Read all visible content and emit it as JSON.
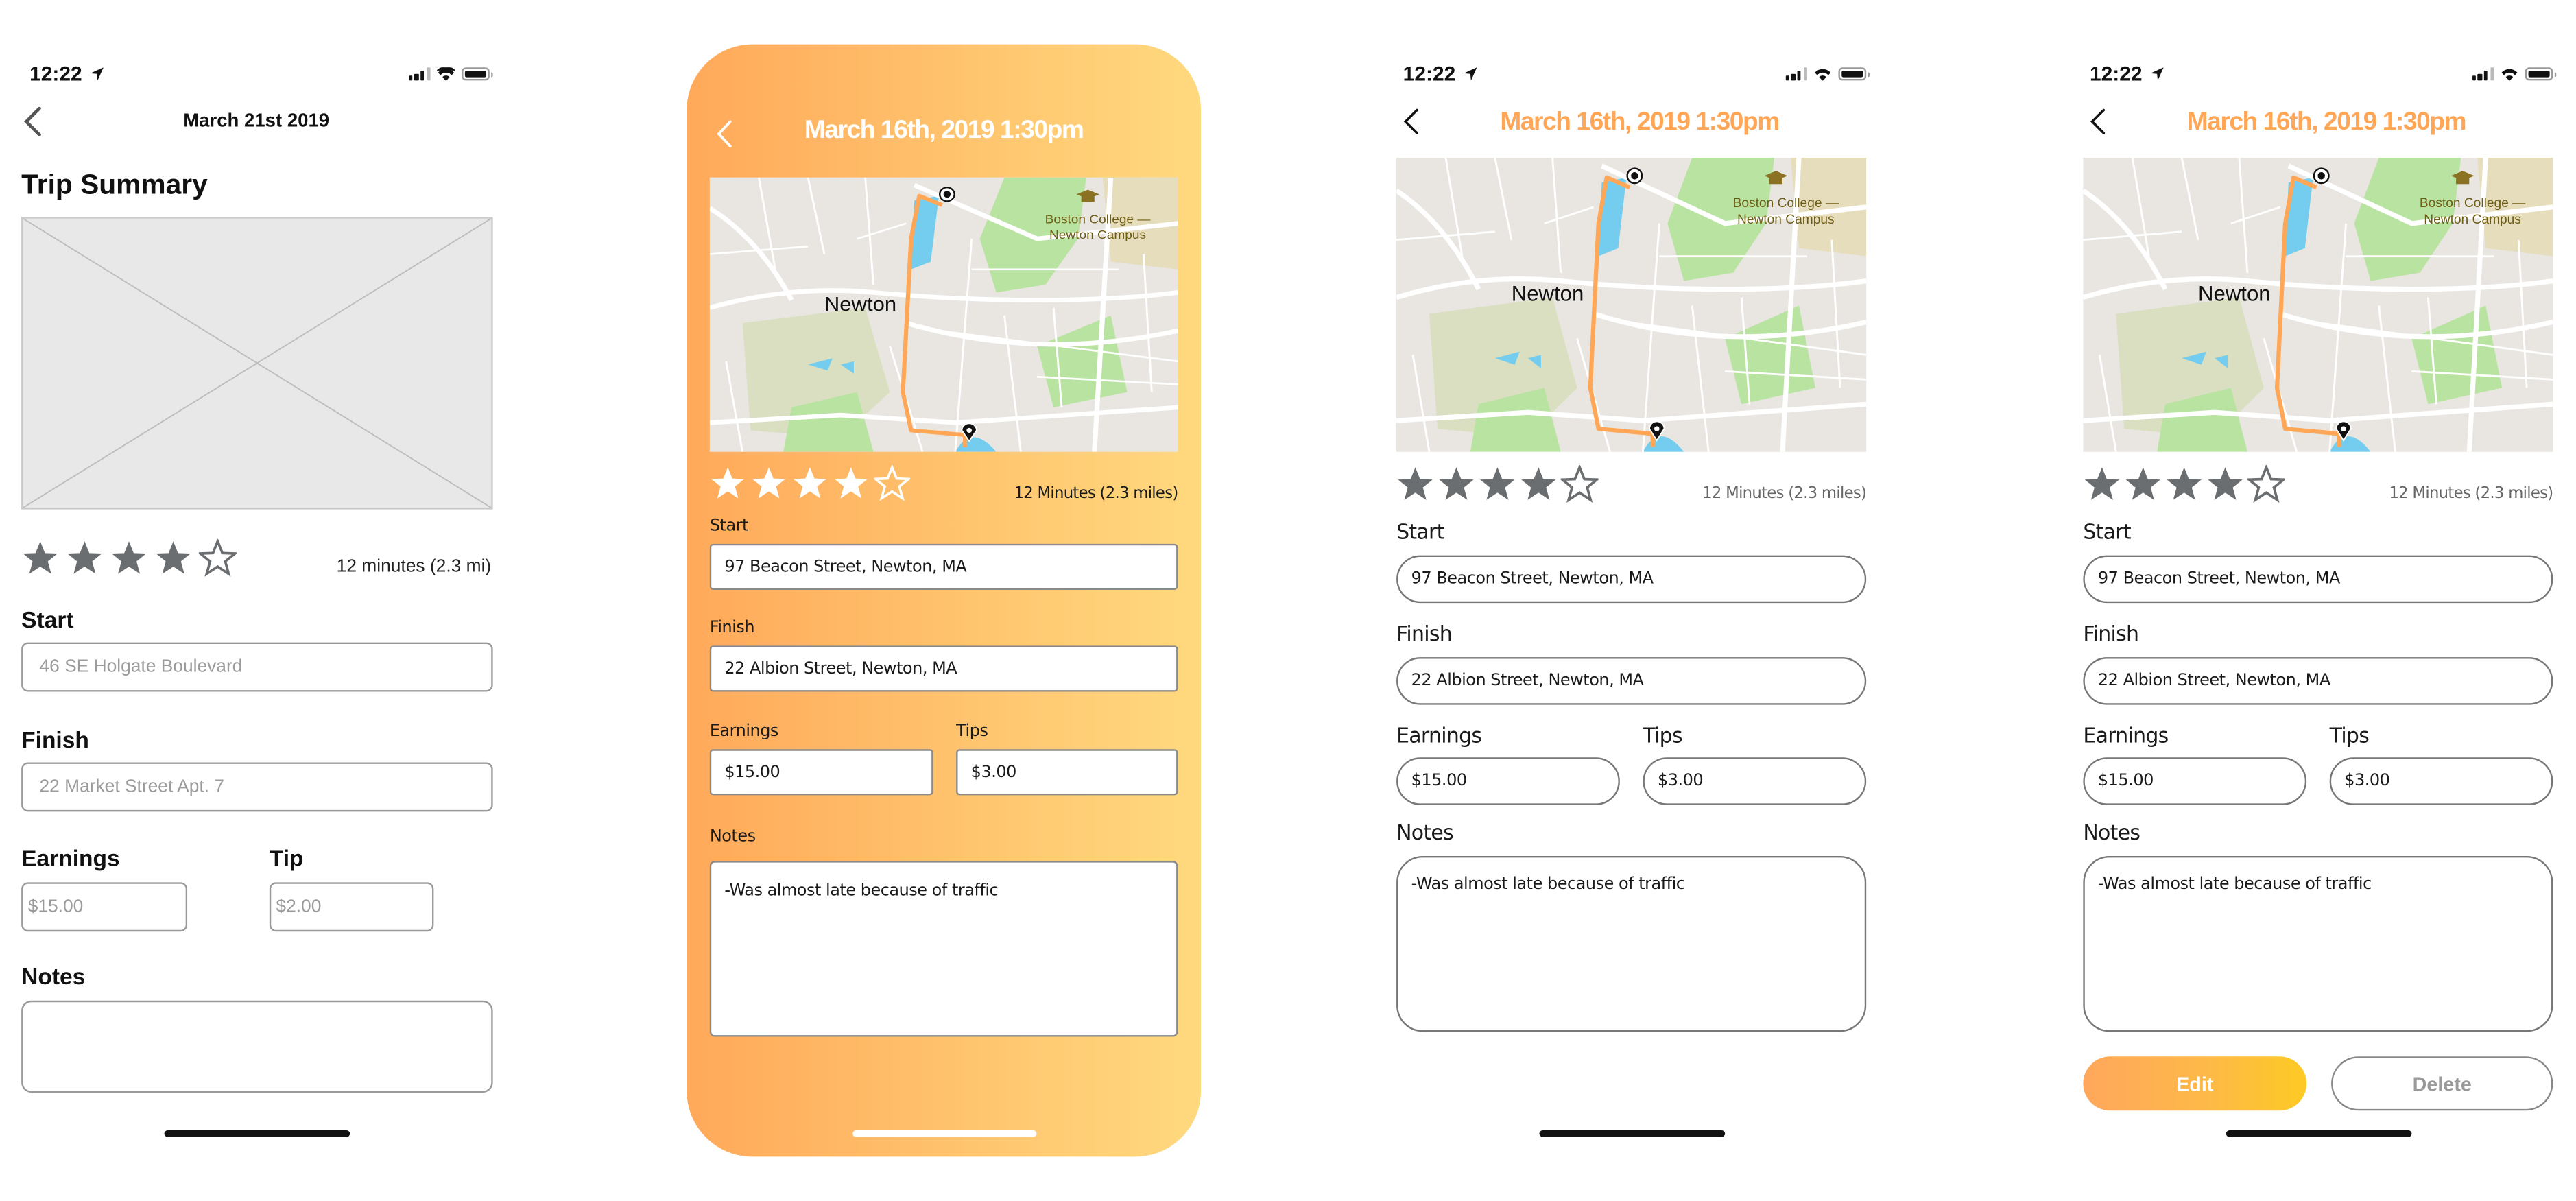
{
  "status_bar": {
    "time": "12:22"
  },
  "screen1": {
    "nav_title": "March 21st 2019",
    "section_title": "Trip Summary",
    "rating": {
      "value": 4,
      "max": 5
    },
    "duration": "12 minutes (2.3 mi)",
    "start": {
      "label": "Start",
      "placeholder": "46 SE Holgate Boulevard"
    },
    "finish": {
      "label": "Finish",
      "placeholder": "22 Market Street Apt. 7"
    },
    "earnings": {
      "label": "Earnings",
      "placeholder": "$15.00"
    },
    "tip": {
      "label": "Tip",
      "placeholder": "$2.00"
    },
    "notes": {
      "label": "Notes",
      "value": ""
    }
  },
  "screen2": {
    "nav_title": "March 16th, 2019 1:30pm",
    "rating": {
      "value": 4,
      "max": 5
    },
    "duration": "12 Minutes (2.3 miles)",
    "start": {
      "label": "Start",
      "value": "97 Beacon Street, Newton, MA"
    },
    "finish": {
      "label": "Finish",
      "value": "22 Albion Street, Newton, MA"
    },
    "earnings": {
      "label": "Earnings",
      "value": "$15.00"
    },
    "tips": {
      "label": "Tips",
      "value": "$3.00"
    },
    "notes": {
      "label": "Notes",
      "value": "-Was almost late because of traffic"
    }
  },
  "screen3": {
    "nav_title": "March 16th, 2019 1:30pm",
    "rating": {
      "value": 4,
      "max": 5
    },
    "duration": "12 Minutes (2.3 miles)",
    "start": {
      "label": "Start",
      "value": "97 Beacon Street, Newton, MA"
    },
    "finish": {
      "label": "Finish",
      "value": "22 Albion Street, Newton, MA"
    },
    "earnings": {
      "label": "Earnings",
      "value": "$15.00"
    },
    "tips": {
      "label": "Tips",
      "value": "$3.00"
    },
    "notes": {
      "label": "Notes",
      "value": "-Was almost late because of traffic"
    }
  },
  "screen4": {
    "nav_title": "March 16th, 2019 1:30pm",
    "rating": {
      "value": 4,
      "max": 5
    },
    "duration": "12 Minutes (2.3 miles)",
    "start": {
      "label": "Start",
      "value": "97 Beacon Street, Newton, MA"
    },
    "finish": {
      "label": "Finish",
      "value": "22 Albion Street, Newton, MA"
    },
    "earnings": {
      "label": "Earnings",
      "value": "$15.00"
    },
    "tips": {
      "label": "Tips",
      "value": "$3.00"
    },
    "notes": {
      "label": "Notes",
      "value": "-Was almost late because of traffic"
    },
    "edit_label": "Edit",
    "delete_label": "Delete"
  },
  "map": {
    "place_label": "Newton",
    "poi_label_line1": "Boston College —",
    "poi_label_line2": "Newton Campus",
    "icons": [
      "start-target-icon",
      "end-pin-icon",
      "graduation-cap-icon"
    ]
  },
  "colors": {
    "accent_orange": "#ffa757",
    "gradient_start": "#ffa95a",
    "gradient_end": "#ffd97e",
    "button_gradient_end": "#fdca24",
    "star_gray": "#6b6e70"
  }
}
